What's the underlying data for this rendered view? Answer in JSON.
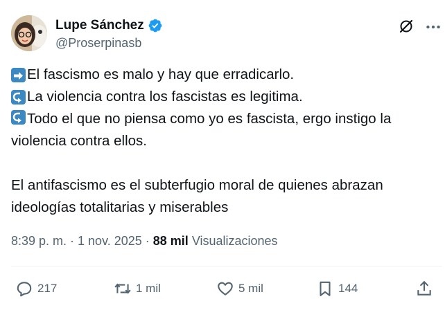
{
  "author": {
    "display_name": "Lupe Sánchez",
    "handle": "@Proserpinasb",
    "verified": true
  },
  "tweet": {
    "lines": [
      {
        "emoji": "right-arrow-emoji",
        "text": "El fascismo es malo y hay que erradicarlo."
      },
      {
        "emoji": "right-arrow-curving-left-emoji",
        "text": "La violencia contra los fascistas es legitima."
      },
      {
        "emoji": "right-arrow-curving-left-emoji",
        "text": "Todo el que no piensa como yo es fascista, ergo instigo la violencia contra ellos."
      }
    ],
    "paragraph": "El antifascismo es el subterfugio moral de quienes abrazan ideologías totalitarias y  miserables"
  },
  "meta": {
    "timestamp": "8:39 p. m. · 1 nov. 2025 · ",
    "views_count": "88 mil",
    "views_label": " Visualizaciones"
  },
  "actions": {
    "replies": "217",
    "reposts": "1 mil",
    "likes": "5 mil",
    "bookmarks": "144"
  },
  "colors": {
    "text": "#0f1419",
    "secondary": "#536471",
    "verified": "#1d9bf0",
    "emoji_blue": "#3b88c3"
  }
}
